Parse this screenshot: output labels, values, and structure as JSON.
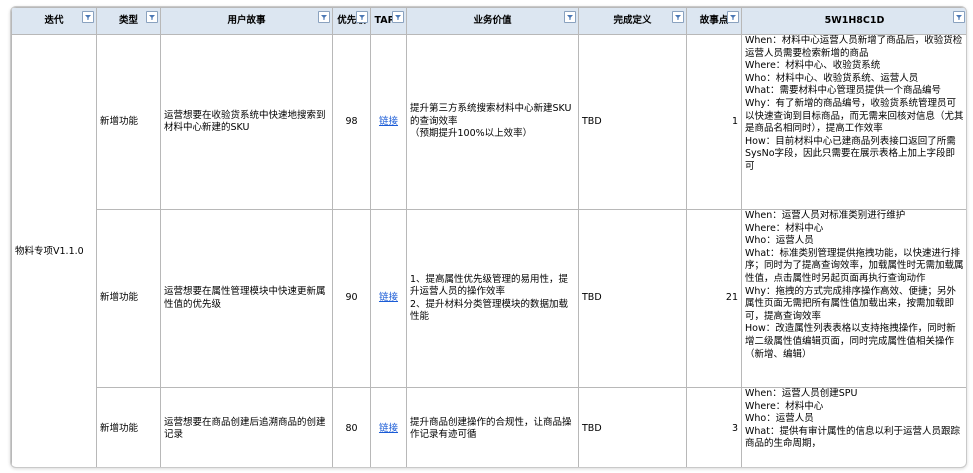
{
  "headers": {
    "iteration": "迭代",
    "type": "类型",
    "story": "用户故事",
    "priority": "优先级",
    "tapd": "TAPD",
    "value": "业务价值",
    "dod": "完成定义",
    "points": "故事点",
    "w5": "5W1H8C1D"
  },
  "iteration_value": "物料专项V1.1.0",
  "rows": [
    {
      "type": "新增功能",
      "story": "运营想要在收验货系统中快速地搜索到材料中心新建的SKU",
      "priority": "98",
      "tapd": "链接",
      "value_lines": [
        "提升第三方系统搜索材料中心新建SKU的查询效率",
        "（预期提升100%以上效率）"
      ],
      "dod": "TBD",
      "points": "1",
      "w5_lines": [
        "When：材料中心运营人员新增了商品后，收验货检运营人员需要检索新增的商品",
        "Where：材料中心、收验货系统",
        "Who：材料中心、收验货系统、运营人员",
        "What：需要材料中心管理员提供一个商品编号",
        "Why：有了新增的商品编号，收验货系统管理员可以快速查询到目标商品，而无需来回核对信息（尤其是商品名相同时），提高工作效率",
        "How：目前材料中心已建商品列表接口返回了所需SysNo字段，因此只需要在展示表格上加上字段即可"
      ]
    },
    {
      "type": "新增功能",
      "story": "运营想要在属性管理模块中快速更新属性值的优先级",
      "priority": "90",
      "tapd": "链接",
      "value_lines": [
        "1、提高属性优先级管理的易用性，提升运营人员的操作效率",
        "2、提升材料分类管理模块的数据加载性能"
      ],
      "dod": "TBD",
      "points": "21",
      "w5_lines": [
        "When：运营人员对标准类别进行维护",
        "Where：材料中心",
        "Who：运营人员",
        "What：标准类别管理提供拖拽功能，以快速进行排序；同时为了提高查询效率，加载属性时无需加载属性值，点击属性时另起页面再执行查询动作",
        "Why：拖拽的方式完成排序操作高效、便捷；另外属性页面无需把所有属性值加载出来，按需加载即可，提高查询效率",
        "How：改造属性列表表格以支持拖拽操作，同时新增二级属性值编辑页面，同时完成属性值相关操作（新增、编辑）"
      ]
    },
    {
      "type": "新增功能",
      "story": "运营想要在商品创建后追溯商品的创建记录",
      "priority": "80",
      "tapd": "链接",
      "value_lines": [
        "提升商品创建操作的合规性，让商品操作记录有迹可循"
      ],
      "dod": "TBD",
      "points": "3",
      "w5_lines": [
        "When：运营人员创建SPU",
        "Where：材料中心",
        "Who：运营人员",
        "What：提供有审计属性的信息以利于运营人员跟踪商品的生命周期，"
      ]
    }
  ]
}
